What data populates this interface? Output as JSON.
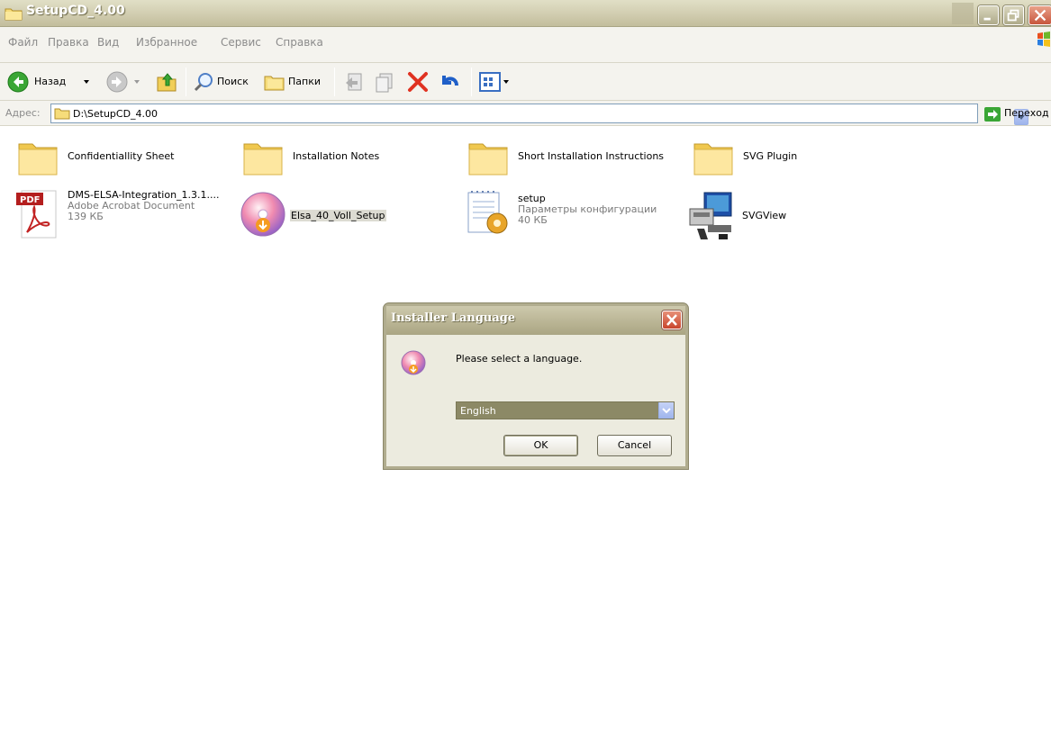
{
  "window": {
    "title": "SetupCD_4.00"
  },
  "menu": {
    "items": [
      "Файл",
      "Правка",
      "Вид",
      "Избранное",
      "Сервис",
      "Справка"
    ]
  },
  "toolbar": {
    "back_label": "Назад",
    "search_label": "Поиск",
    "folders_label": "Папки"
  },
  "address": {
    "label": "Адрес:",
    "path": "D:\\SetupCD_4.00",
    "go_label": "Переход"
  },
  "files": [
    {
      "name": "Confidentiallity Sheet",
      "type": "folder"
    },
    {
      "name": "Installation Notes",
      "type": "folder"
    },
    {
      "name": "Short Installation Instructions",
      "type": "folder"
    },
    {
      "name": "SVG Plugin",
      "type": "folder"
    },
    {
      "name": "DMS-ELSA-Integration_1.3.1....",
      "type": "pdf",
      "desc": "Adobe Acrobat Document",
      "size": "139 КБ"
    },
    {
      "name": "Elsa_40_Voll_Setup",
      "type": "installer"
    },
    {
      "name": "setup",
      "type": "config",
      "desc": "Параметры конфигурации",
      "size": "40 КБ"
    },
    {
      "name": "SVGView",
      "type": "program"
    }
  ],
  "dialog": {
    "title": "Installer Language",
    "message": "Please select a language.",
    "selected_language": "English",
    "ok_label": "OK",
    "cancel_label": "Cancel"
  },
  "colors": {
    "titlebar": "#c8c4a6",
    "dialog_bg": "#ecebdf",
    "combo_selected": "#8c8966"
  }
}
